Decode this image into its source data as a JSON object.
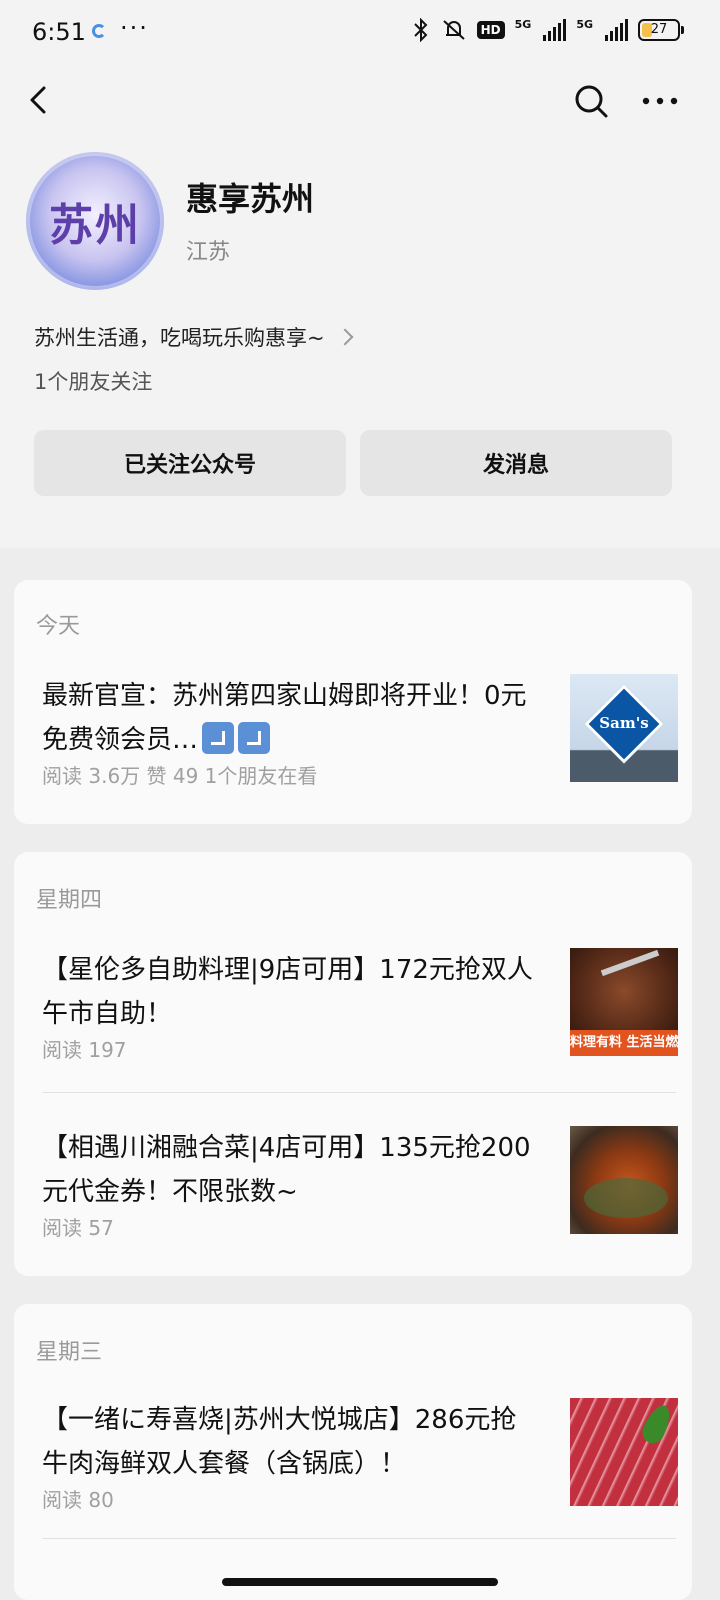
{
  "status_bar": {
    "time": "6:51",
    "hd_label": "HD",
    "net1": "5G",
    "net2": "5G",
    "battery": "27",
    "battery_level": 0.27
  },
  "profile": {
    "avatar_text": "苏州",
    "name": "惠享苏州",
    "region": "江苏",
    "description": "苏州生活通，吃喝玩乐购惠享~",
    "friends": "1个朋友关注",
    "follow_button": "已关注公众号",
    "message_button": "发消息"
  },
  "groups": [
    {
      "day": "今天",
      "articles": [
        {
          "title": "最新官宣：苏州第四家山姆即将开业！0元免费领会员…",
          "meta": "阅读 3.6万   赞 49   1个朋友在看",
          "thumb_text": "Sam's"
        }
      ]
    },
    {
      "day": "星期四",
      "articles": [
        {
          "title": "【星伦多自助料理|9店可用】172元抢双人午市自助！",
          "meta": "阅读 197",
          "thumb_text": "料理有料 生活当燃"
        },
        {
          "title": "【相遇川湘融合菜|4店可用】135元抢200元代金券！不限张数~",
          "meta": "阅读 57"
        }
      ]
    },
    {
      "day": "星期三",
      "articles": [
        {
          "title": "【一绪に寿喜烧|苏州大悦城店】286元抢牛肉海鲜双人套餐（含锅底）！",
          "meta": "阅读 80"
        }
      ]
    }
  ]
}
